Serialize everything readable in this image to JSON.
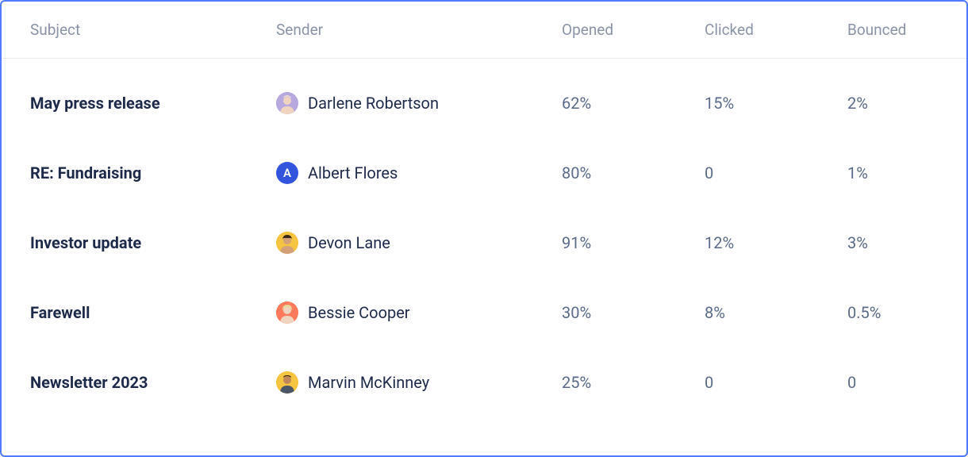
{
  "headers": {
    "subject": "Subject",
    "sender": "Sender",
    "opened": "Opened",
    "clicked": "Clicked",
    "bounced": "Bounced"
  },
  "rows": [
    {
      "subject": "May press release",
      "sender": "Darlene Robertson",
      "avatar_type": "photo",
      "avatar_bg": "#b8a8e0",
      "avatar_face": "#f0d4c0",
      "avatar_hair": "#f5e8d0",
      "opened": "62%",
      "clicked": "15%",
      "bounced": "2%"
    },
    {
      "subject": "RE: Fundraising",
      "sender": "Albert Flores",
      "avatar_type": "letter",
      "avatar_letter": "A",
      "avatar_bg": "#3355dd",
      "opened": "80%",
      "clicked": "0",
      "bounced": "1%"
    },
    {
      "subject": "Investor update",
      "sender": "Devon Lane",
      "avatar_type": "photo",
      "avatar_bg": "#f5c542",
      "avatar_face": "#d4a078",
      "avatar_hair": "#3a2818",
      "opened": "91%",
      "clicked": "12%",
      "bounced": "3%"
    },
    {
      "subject": "Farewell",
      "sender": "Bessie Cooper",
      "avatar_type": "photo",
      "avatar_bg": "#ff7a5c",
      "avatar_face": "#f0d4c0",
      "avatar_hair": "#e8d898",
      "opened": "30%",
      "clicked": "8%",
      "bounced": "0.5%"
    },
    {
      "subject": "Newsletter 2023",
      "sender": "Marvin McKinney",
      "avatar_type": "photo",
      "avatar_bg": "#f5c542",
      "avatar_face": "#c08858",
      "avatar_hair": "#2a1810",
      "opened": "25%",
      "clicked": "0",
      "bounced": "0"
    }
  ]
}
